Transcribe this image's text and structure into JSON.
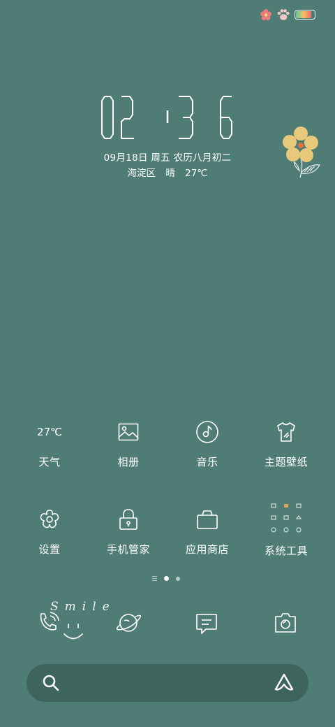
{
  "status_bar": {
    "icons": [
      "flower-icon",
      "paw-icon",
      "battery-icon"
    ],
    "battery_level": 0.85,
    "colors": {
      "flower": "#e97a7f",
      "paw": "#f4c6c6",
      "battery_gradient": [
        "#5fc7a0",
        "#f2c35c",
        "#ef6b73"
      ]
    }
  },
  "clock": {
    "hours": "02",
    "minutes": "36"
  },
  "date": {
    "text": "09月18日 周五 农历八月初二"
  },
  "weather": {
    "location": "海淀区",
    "condition": "晴",
    "temperature": "27℃"
  },
  "apps": [
    {
      "label": "天气",
      "icon_text": "27℃",
      "icon": "weather-icon"
    },
    {
      "label": "相册",
      "icon": "gallery-icon"
    },
    {
      "label": "音乐",
      "icon": "music-icon"
    },
    {
      "label": "主题壁纸",
      "icon": "theme-shirt-icon"
    },
    {
      "label": "设置",
      "icon": "settings-flower-icon"
    },
    {
      "label": "手机管家",
      "icon": "lock-icon"
    },
    {
      "label": "应用商店",
      "icon": "store-bag-icon"
    },
    {
      "label": "系统工具",
      "icon": "tools-folder-icon"
    }
  ],
  "page_indicator": {
    "pages": 2,
    "active": 0
  },
  "dock": {
    "decoration_text": "Smile",
    "items": [
      "phone-icon",
      "browser-planet-icon",
      "messages-icon",
      "camera-icon"
    ]
  },
  "search_bar": {
    "icons": [
      "search-icon",
      "assistant-icon"
    ]
  },
  "colors": {
    "background": "#4f7d76",
    "flower_petal": "#e8c97c",
    "flower_center": "#e5703d"
  }
}
